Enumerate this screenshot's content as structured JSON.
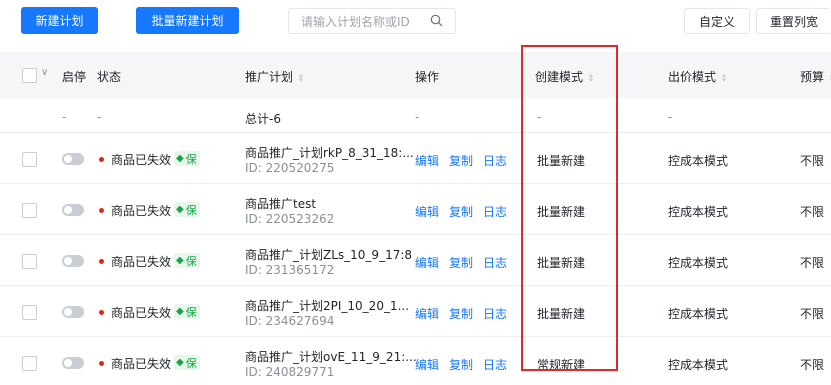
{
  "toolbar": {
    "new_plan": "新建计划",
    "batch_new_plan": "批量新建计划",
    "search_placeholder": "请输入计划名称或ID",
    "customize": "自定义",
    "reset_width": "重置列宽"
  },
  "columns": {
    "start_stop": "启停",
    "status": "状态",
    "plan": "推广计划",
    "action": "操作",
    "create_mode": "创建模式",
    "bid_mode": "出价模式",
    "budget": "预算"
  },
  "summary": {
    "c1": "-",
    "c2": "-",
    "plan": "总计-6",
    "action": "-",
    "create_mode": "-",
    "bid_mode": "-"
  },
  "row_labels": {
    "status": "商品已失效",
    "guarantee": "保",
    "edit": "编辑",
    "copy": "复制",
    "log": "日志"
  },
  "rows": [
    {
      "name": "商品推广_计划rkP_8_31_18:...",
      "id": "ID: 220520275",
      "create_mode": "批量新建",
      "bid_mode": "控成本模式",
      "budget": "不限"
    },
    {
      "name": "商品推广test",
      "id": "ID: 220523262",
      "create_mode": "批量新建",
      "bid_mode": "控成本模式",
      "budget": "不限"
    },
    {
      "name": "商品推广_计划ZLs_10_9_17:8",
      "id": "ID: 231365172",
      "create_mode": "批量新建",
      "bid_mode": "控成本模式",
      "budget": "不限"
    },
    {
      "name": "商品推广_计划2PI_10_20_1...",
      "id": "ID: 234627694",
      "create_mode": "批量新建",
      "bid_mode": "控成本模式",
      "budget": "不限"
    },
    {
      "name": "商品推广_计划ovE_11_9_21:...",
      "id": "ID: 240829771",
      "create_mode": "常规新建",
      "bid_mode": "控成本模式",
      "budget": "不限"
    }
  ],
  "colors": {
    "accent": "#1677ff",
    "status_dot": "#e5251b",
    "highlight_box": "#e0282a"
  }
}
